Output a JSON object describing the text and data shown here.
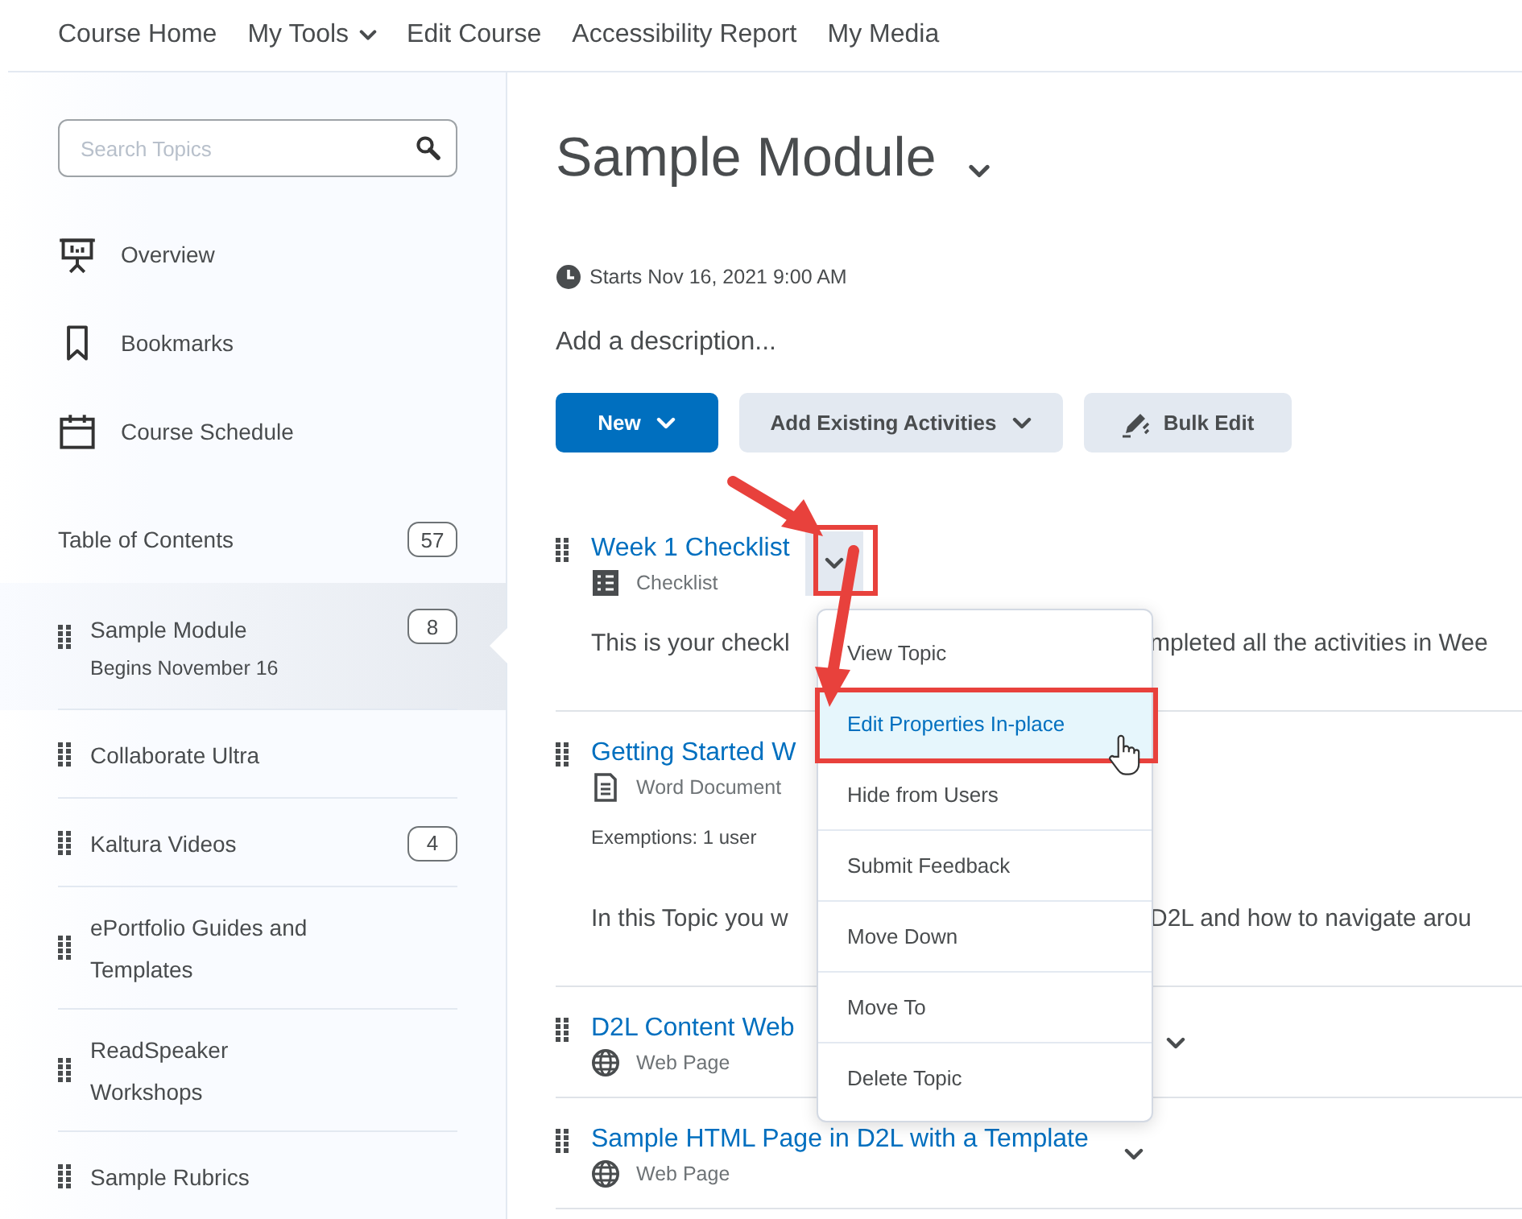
{
  "nav": [
    {
      "label": "Course Home",
      "has_menu": false
    },
    {
      "label": "My Tools",
      "has_menu": true
    },
    {
      "label": "Edit Course",
      "has_menu": false
    },
    {
      "label": "Accessibility Report",
      "has_menu": false
    },
    {
      "label": "My Media",
      "has_menu": false
    }
  ],
  "sidebar": {
    "search": {
      "placeholder": "Search Topics"
    },
    "links": [
      {
        "label": "Overview"
      },
      {
        "label": "Bookmarks"
      },
      {
        "label": "Course Schedule"
      }
    ],
    "toc": {
      "label": "Table of Contents",
      "count": "57"
    },
    "modules": [
      {
        "title": "Sample Module",
        "subtitle": "Begins November 16",
        "count": "8",
        "selected": true
      },
      {
        "title": "Collaborate Ultra",
        "selected": false
      },
      {
        "title": "Kaltura Videos",
        "count": "4",
        "selected": false
      },
      {
        "title": "ePortfolio Guides and Templates",
        "selected": false
      },
      {
        "title": "ReadSpeaker Workshops",
        "selected": false
      },
      {
        "title": "Sample Rubrics",
        "selected": false
      }
    ]
  },
  "module": {
    "title": "Sample Module",
    "start": "Starts Nov 16, 2021 9:00 AM",
    "description_placeholder": "Add a description...",
    "buttons": [
      {
        "label": "New",
        "kind": "primary"
      },
      {
        "label": "Add Existing Activities",
        "kind": "dropdown"
      },
      {
        "label": "Bulk Edit",
        "kind": "edit"
      }
    ],
    "topics": [
      {
        "title": "Week 1 Checklist",
        "type": "Checklist",
        "kind": "checklist",
        "menu_open": true,
        "description": [
          "This is your checkl",
          "mpleted all the activities in Wee"
        ]
      },
      {
        "title": "Getting Started W",
        "type": "Word Document",
        "kind": "document",
        "exemptions": "Exemptions: 1 user",
        "description": [
          "In this Topic you w",
          "D2L and how to navigate arou"
        ]
      },
      {
        "title": "D2L Content Web",
        "type": "Web Page",
        "kind": "web",
        "menu_open": false
      },
      {
        "title": "Sample HTML Page in D2L with a Template",
        "type": "Web Page",
        "kind": "web",
        "menu_open": false
      }
    ]
  },
  "context_menu": {
    "items": [
      {
        "label": "View Topic",
        "selected": false
      },
      {
        "label": "Edit Properties In-place",
        "selected": true
      },
      {
        "label": "Hide from Users",
        "selected": false
      },
      {
        "label": "Submit Feedback",
        "selected": false
      },
      {
        "label": "Move Down",
        "selected": false
      },
      {
        "label": "Move To",
        "selected": false
      },
      {
        "label": "Delete Topic",
        "selected": false
      }
    ]
  }
}
